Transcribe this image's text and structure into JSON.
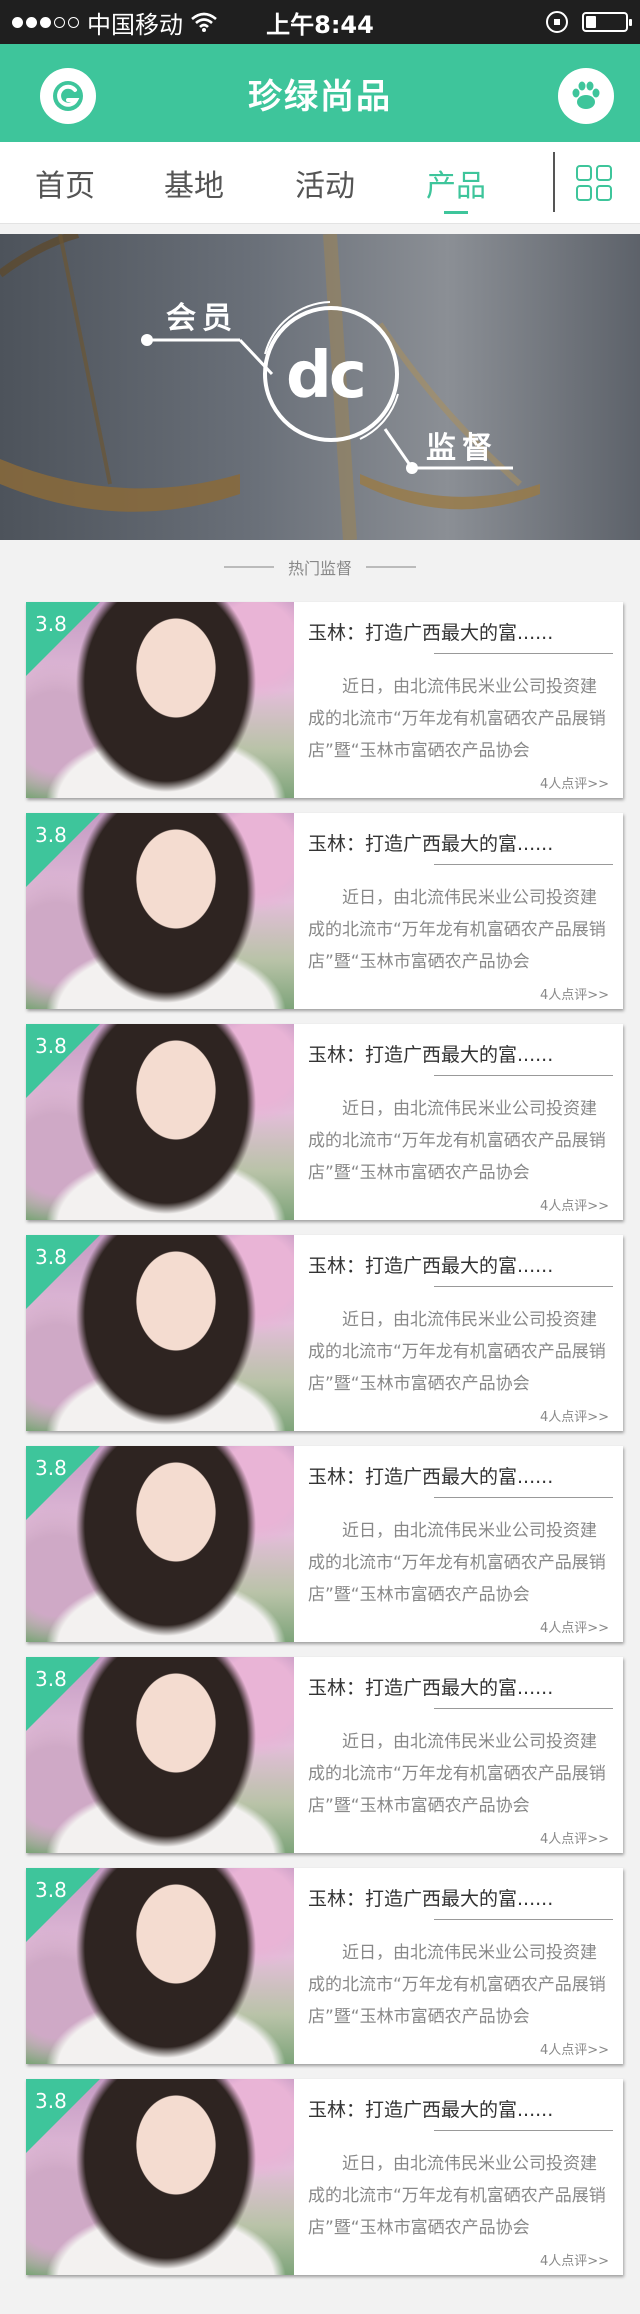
{
  "status_bar": {
    "signal_dots": [
      true,
      true,
      true,
      false,
      false
    ],
    "carrier": "中国移动",
    "time": "上午8:44",
    "battery_level": 0.25
  },
  "header": {
    "title": "珍绿尚品",
    "left_icon": "logo-g-icon",
    "right_icon": "paw-icon"
  },
  "tabs": {
    "items": [
      {
        "label": "首页",
        "active": false
      },
      {
        "label": "基地",
        "active": false
      },
      {
        "label": "活动",
        "active": false
      },
      {
        "label": "产品",
        "active": true
      }
    ],
    "grid_icon": "grid-icon"
  },
  "banner": {
    "label_a": "会员",
    "label_b": "监督",
    "logo_text": "dc"
  },
  "section": {
    "title": "热门监督"
  },
  "cards": [
    {
      "score": "3.8",
      "title": "玉林：打造广西最大的富......",
      "text": "近日，由北流伟民米业公司投资建成的北流市“万年龙有机富硒农产品展销店”暨“玉林市富硒农产品协会",
      "meta": "4人点评>>"
    },
    {
      "score": "3.8",
      "title": "玉林：打造广西最大的富......",
      "text": "近日，由北流伟民米业公司投资建成的北流市“万年龙有机富硒农产品展销店”暨“玉林市富硒农产品协会",
      "meta": "4人点评>>"
    },
    {
      "score": "3.8",
      "title": "玉林：打造广西最大的富......",
      "text": "近日，由北流伟民米业公司投资建成的北流市“万年龙有机富硒农产品展销店”暨“玉林市富硒农产品协会",
      "meta": "4人点评>>"
    },
    {
      "score": "3.8",
      "title": "玉林：打造广西最大的富......",
      "text": "近日，由北流伟民米业公司投资建成的北流市“万年龙有机富硒农产品展销店”暨“玉林市富硒农产品协会",
      "meta": "4人点评>>"
    },
    {
      "score": "3.8",
      "title": "玉林：打造广西最大的富......",
      "text": "近日，由北流伟民米业公司投资建成的北流市“万年龙有机富硒农产品展销店”暨“玉林市富硒农产品协会",
      "meta": "4人点评>>"
    },
    {
      "score": "3.8",
      "title": "玉林：打造广西最大的富......",
      "text": "近日，由北流伟民米业公司投资建成的北流市“万年龙有机富硒农产品展销店”暨“玉林市富硒农产品协会",
      "meta": "4人点评>>"
    },
    {
      "score": "3.8",
      "title": "玉林：打造广西最大的富......",
      "text": "近日，由北流伟民米业公司投资建成的北流市“万年龙有机富硒农产品展销店”暨“玉林市富硒农产品协会",
      "meta": "4人点评>>"
    },
    {
      "score": "3.8",
      "title": "玉林：打造广西最大的富......",
      "text": "近日，由北流伟民米业公司投资建成的北流市“万年龙有机富硒农产品展销店”暨“玉林市富硒农产品协会",
      "meta": "4人点评>>"
    }
  ],
  "colors": {
    "accent": "#3ec59b",
    "status_bar_bg": "#1f1f1f",
    "page_bg": "#f2f2f2"
  }
}
